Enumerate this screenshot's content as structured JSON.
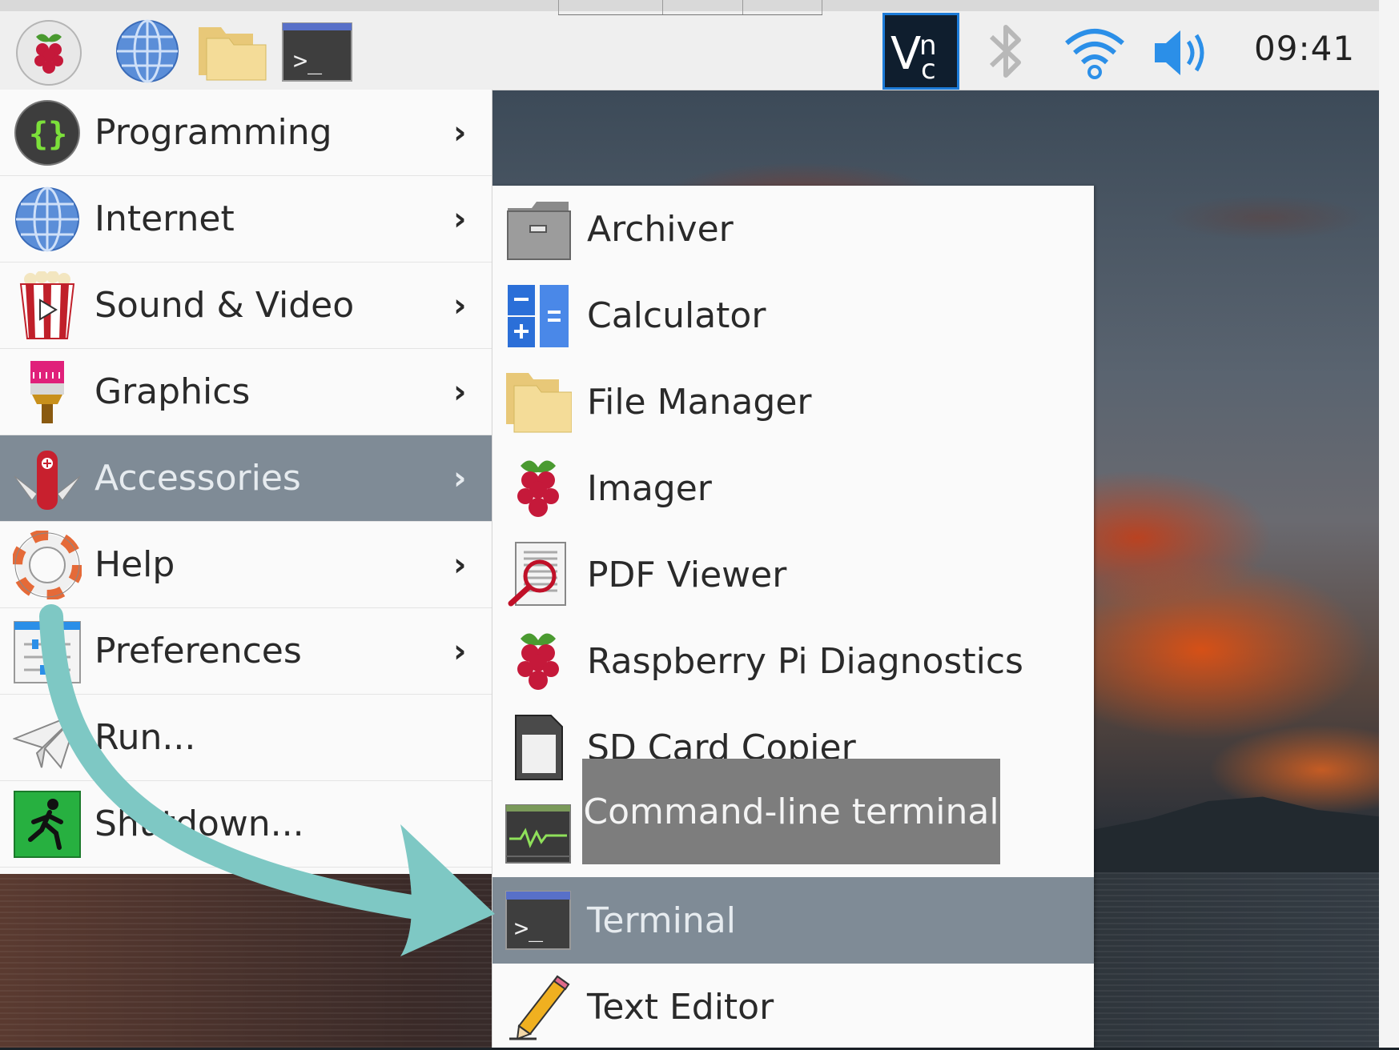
{
  "panel": {
    "launchers": [
      {
        "icon": "raspberry-menu-icon"
      },
      {
        "icon": "web-browser-icon"
      },
      {
        "icon": "file-manager-icon"
      },
      {
        "icon": "terminal-icon"
      }
    ],
    "tray": [
      {
        "icon": "vnc-icon"
      },
      {
        "icon": "bluetooth-icon"
      },
      {
        "icon": "wifi-icon"
      },
      {
        "icon": "volume-icon"
      }
    ],
    "clock": "09:41"
  },
  "menu": {
    "items": [
      {
        "label": "Programming",
        "icon": "programming-icon",
        "has_submenu": true
      },
      {
        "label": "Internet",
        "icon": "internet-icon",
        "has_submenu": true
      },
      {
        "label": "Sound & Video",
        "icon": "sound-video-icon",
        "has_submenu": true
      },
      {
        "label": "Graphics",
        "icon": "graphics-icon",
        "has_submenu": true
      },
      {
        "label": "Accessories",
        "icon": "accessories-icon",
        "has_submenu": true,
        "active": true
      },
      {
        "label": "Help",
        "icon": "help-icon",
        "has_submenu": true
      },
      {
        "label": "Preferences",
        "icon": "preferences-icon",
        "has_submenu": true
      },
      {
        "label": "Run...",
        "icon": "run-icon",
        "has_submenu": false
      },
      {
        "label": "Shutdown...",
        "icon": "shutdown-icon",
        "has_submenu": false
      }
    ],
    "chevron": "›"
  },
  "submenu": {
    "items": [
      {
        "label": "Archiver",
        "icon": "archiver-icon"
      },
      {
        "label": "Calculator",
        "icon": "calculator-icon"
      },
      {
        "label": "File Manager",
        "icon": "file-manager-icon"
      },
      {
        "label": "Imager",
        "icon": "imager-icon"
      },
      {
        "label": "PDF Viewer",
        "icon": "pdf-viewer-icon"
      },
      {
        "label": "Raspberry Pi Diagnostics",
        "icon": "diagnostics-icon"
      },
      {
        "label": "SD Card Copier",
        "icon": "sd-card-icon"
      },
      {
        "label": "",
        "icon": "task-manager-icon"
      },
      {
        "label": "Terminal",
        "icon": "terminal-icon",
        "active": true
      },
      {
        "label": "Text Editor",
        "icon": "text-editor-icon"
      }
    ]
  },
  "tooltip": {
    "text": "Command-line terminal"
  },
  "colors": {
    "highlight": "#7f8b96",
    "annotation_arrow": "#7ec8c4",
    "menu_background": "#fafafa",
    "panel_background": "#efefef"
  }
}
